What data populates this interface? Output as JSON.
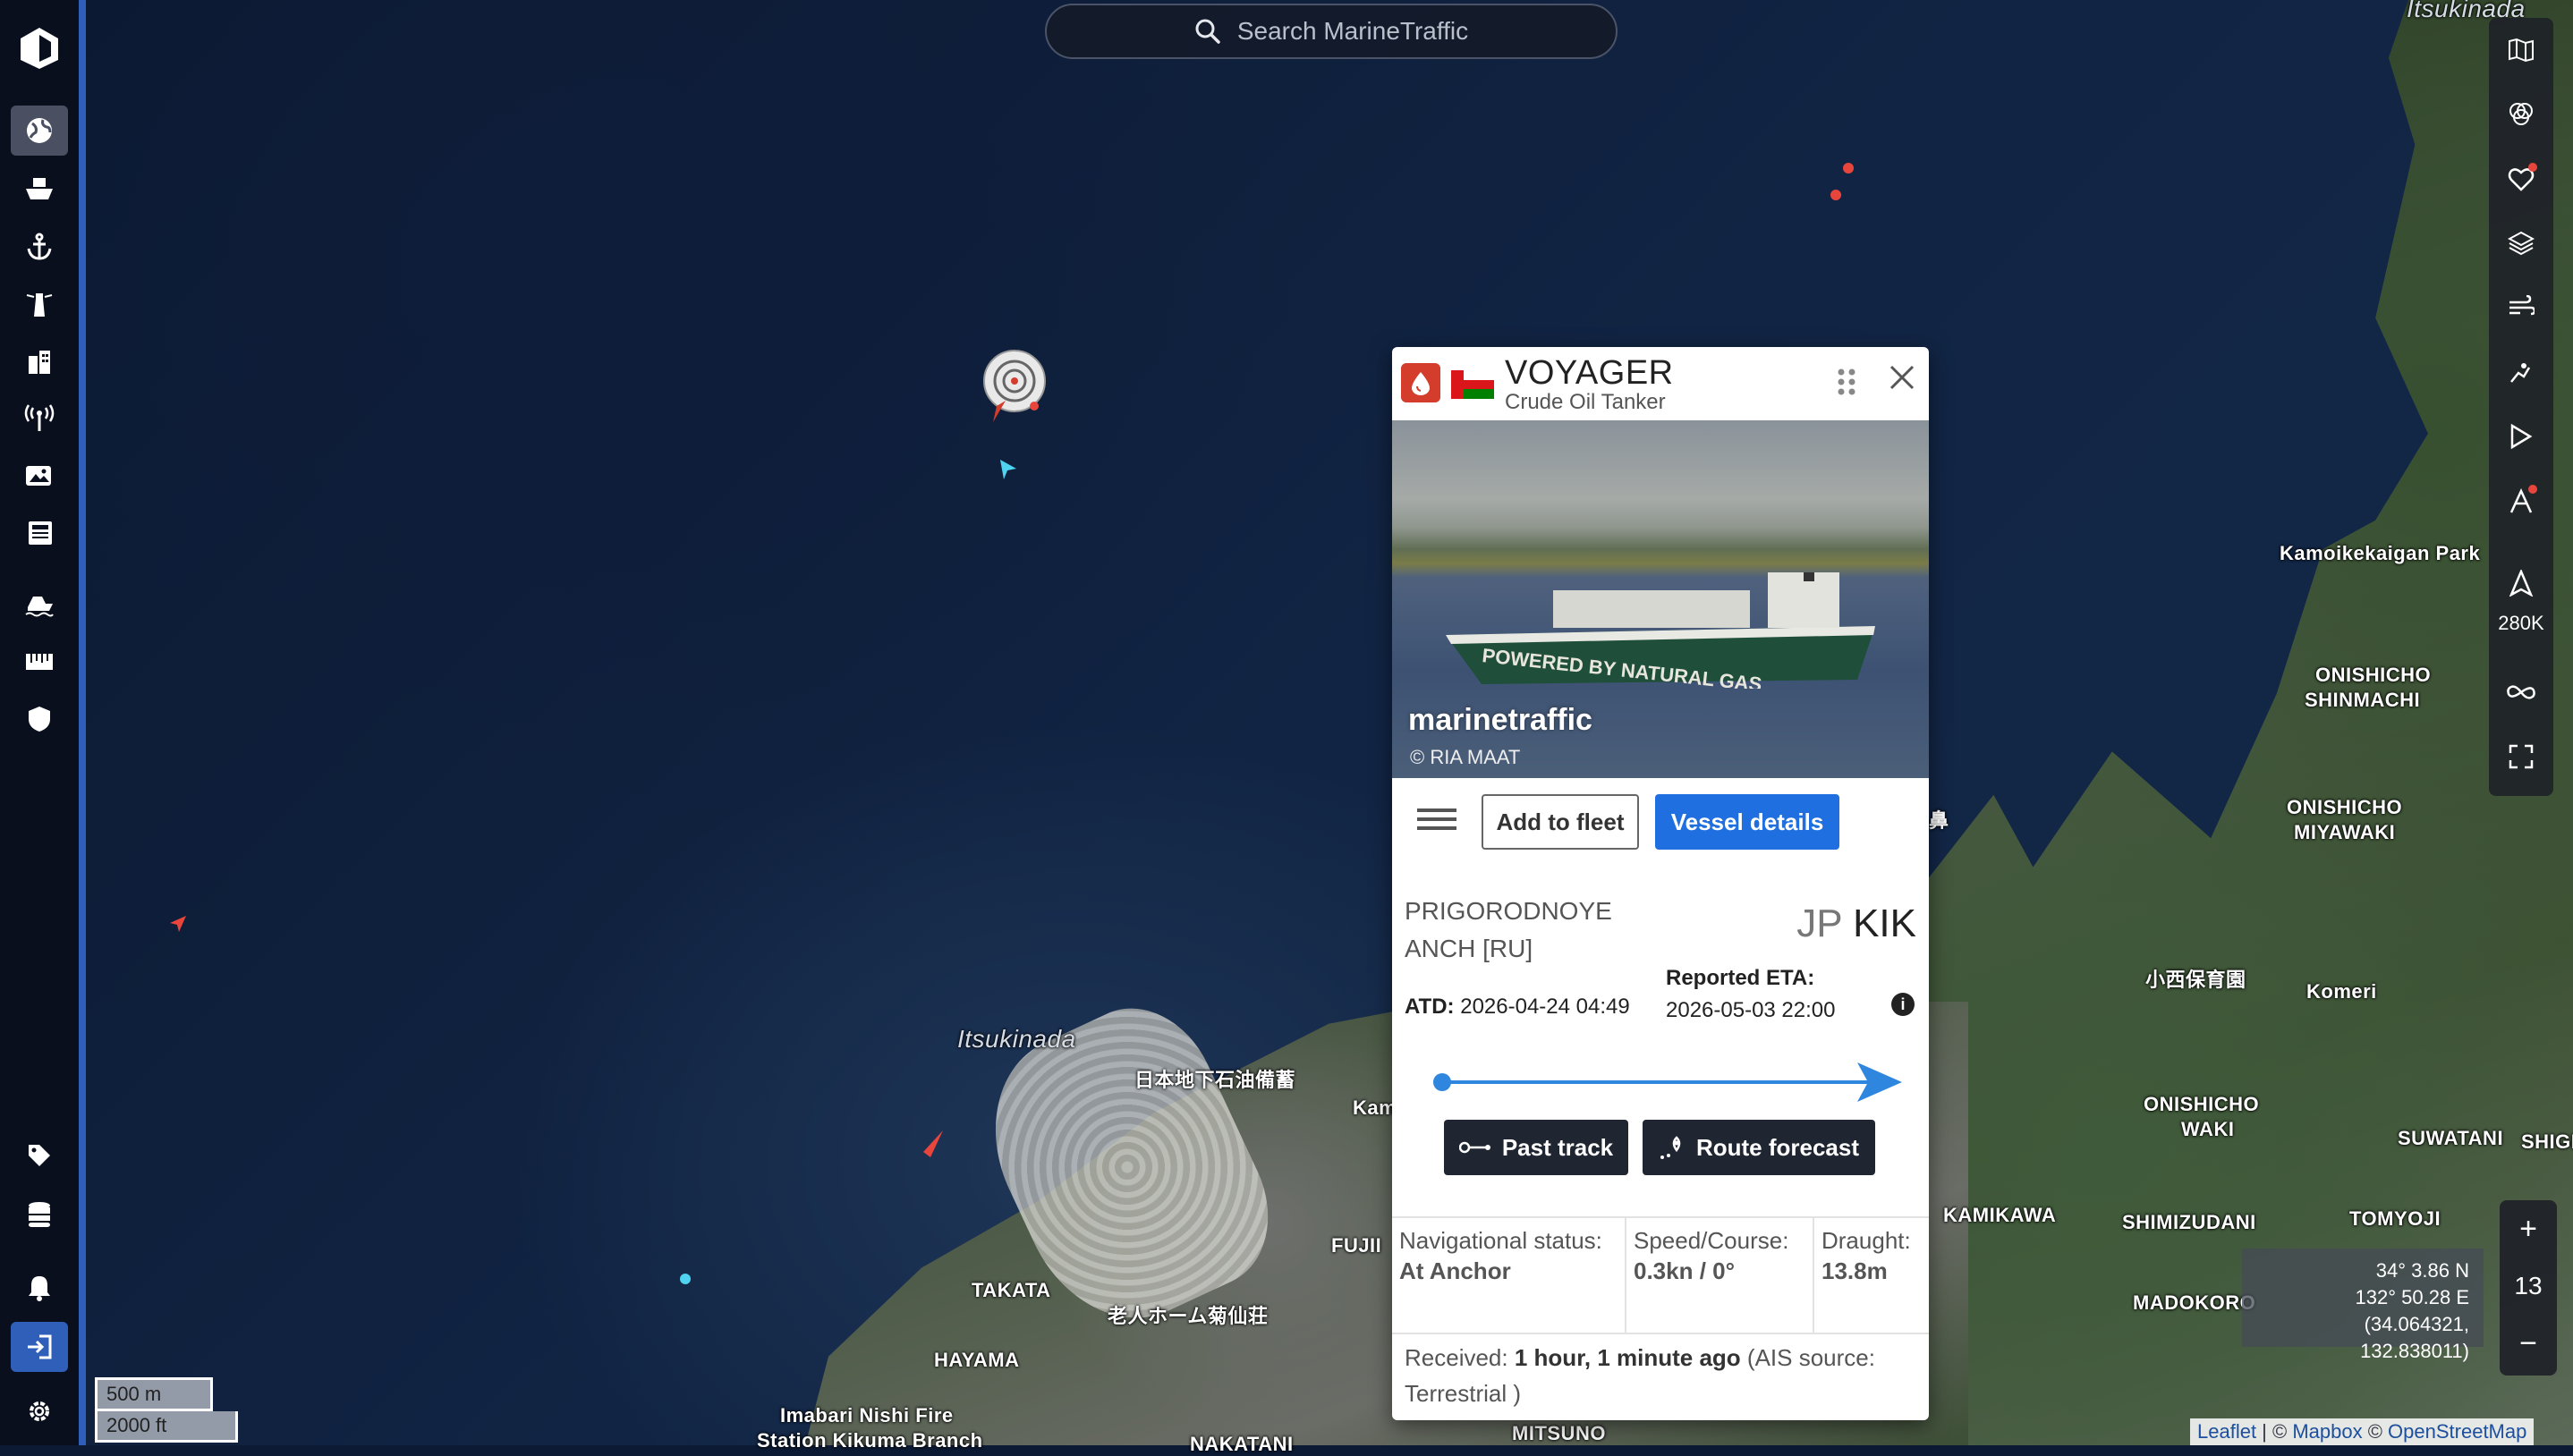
{
  "search": {
    "placeholder": "Search MarineTraffic"
  },
  "map": {
    "labels": {
      "itsukinada_top": "Itsukinada",
      "itsukinada": "Itsukinada",
      "kamoike": "Kamoikekaigan Park",
      "nishicho_shinmachi_1": "ONISHICHO",
      "nishicho_shinmachi_2": "SHINMACHI",
      "onishicho_miyawaki_1": "ONISHICHO",
      "onishicho_miyawaki_2": "MIYAWAKI",
      "konishi": "小西保育園",
      "komeri": "Komeri",
      "onishicho_waki_1": "ONISHICHO",
      "onishicho_waki_2": "WAKI",
      "suwatani": "SUWATANI",
      "shige": "SHIGE",
      "kamikawa": "KAMIKAWA",
      "shimizudani": "SHIMIZUDANI",
      "tomyoji": "TOMYOJI",
      "madokoro": "MADOKORO",
      "oil_storage": "日本地下石油備蓄",
      "kam": "Kam",
      "fujii": "FUJII",
      "takata": "TAKATA",
      "roujin": "老人ホーム菊仙荘",
      "hayama": "HAYAMA",
      "fire_1": "Imabari Nishi Fire",
      "fire_2": "Station Kikuma Branch",
      "nakatani": "NAKATANI",
      "mitsuno": "MITSUNO",
      "kanji_edge": "鼻"
    },
    "scale": {
      "metric": "500 m",
      "imperial": "2000 ft"
    },
    "coords": {
      "lat": "34° 3.86 N",
      "lon": "132° 50.28 E",
      "decimal": "(34.064321, 132.838011)"
    },
    "zoom": {
      "plus": "+",
      "level": "13",
      "minus": "−"
    },
    "attribution": {
      "leaflet": "Leaflet",
      "sep": " | © ",
      "mapbox": "Mapbox",
      "osm_prefix": " © ",
      "osm": "OpenStreetMap"
    },
    "right_toolbar": {
      "capacity_label": "280K"
    }
  },
  "left_nav": {
    "icons": [
      "logo-icon",
      "globe-icon",
      "ship-icon",
      "anchor-icon",
      "lighthouse-icon",
      "buildings-icon",
      "antenna-icon",
      "photos-icon",
      "news-icon",
      "vessel-icon",
      "ruler-icon",
      "shield-icon",
      "tag-icon",
      "database-icon",
      "bell-icon",
      "login-icon",
      "gear-icon"
    ]
  },
  "vessel": {
    "name": "VOYAGER",
    "type": "Crude Oil Tanker",
    "flag_colors": {
      "red": "#db161b",
      "white": "#ffffff",
      "green": "#008000"
    },
    "photo": {
      "logo": "marinetraffic",
      "credit": "© RIA MAAT",
      "hull_text": "POWERED BY NATURAL GAS"
    },
    "add_to_fleet": "Add to fleet",
    "vessel_details": "Vessel details",
    "origin": "PRIGORODNOYE ANCH [RU]",
    "dest_country": "JP",
    "dest_port": "KIK",
    "atd_label": "ATD:",
    "atd_value": "2026-04-24 04:49",
    "eta_label": "Reported ETA:",
    "eta_value": "2026-05-03 22:00",
    "voyage_progress": 1.0,
    "past_track": "Past track",
    "route_forecast": "Route forecast",
    "nav_status_label": "Navigational status:",
    "nav_status_value": "At Anchor",
    "speed_label": "Speed/Course:",
    "speed_value": "0.3kn / 0°",
    "draught_label": "Draught:",
    "draught_value": "13.8m",
    "received_label": "Received:",
    "received_value": "1 hour, 1 minute ago",
    "received_source": "(AIS source: Terrestrial )"
  },
  "colors": {
    "accent": "#1f6fe0",
    "nav_border": "#2f5fb8",
    "tanker_red": "#d43c2c",
    "progress": "#2e86de"
  }
}
